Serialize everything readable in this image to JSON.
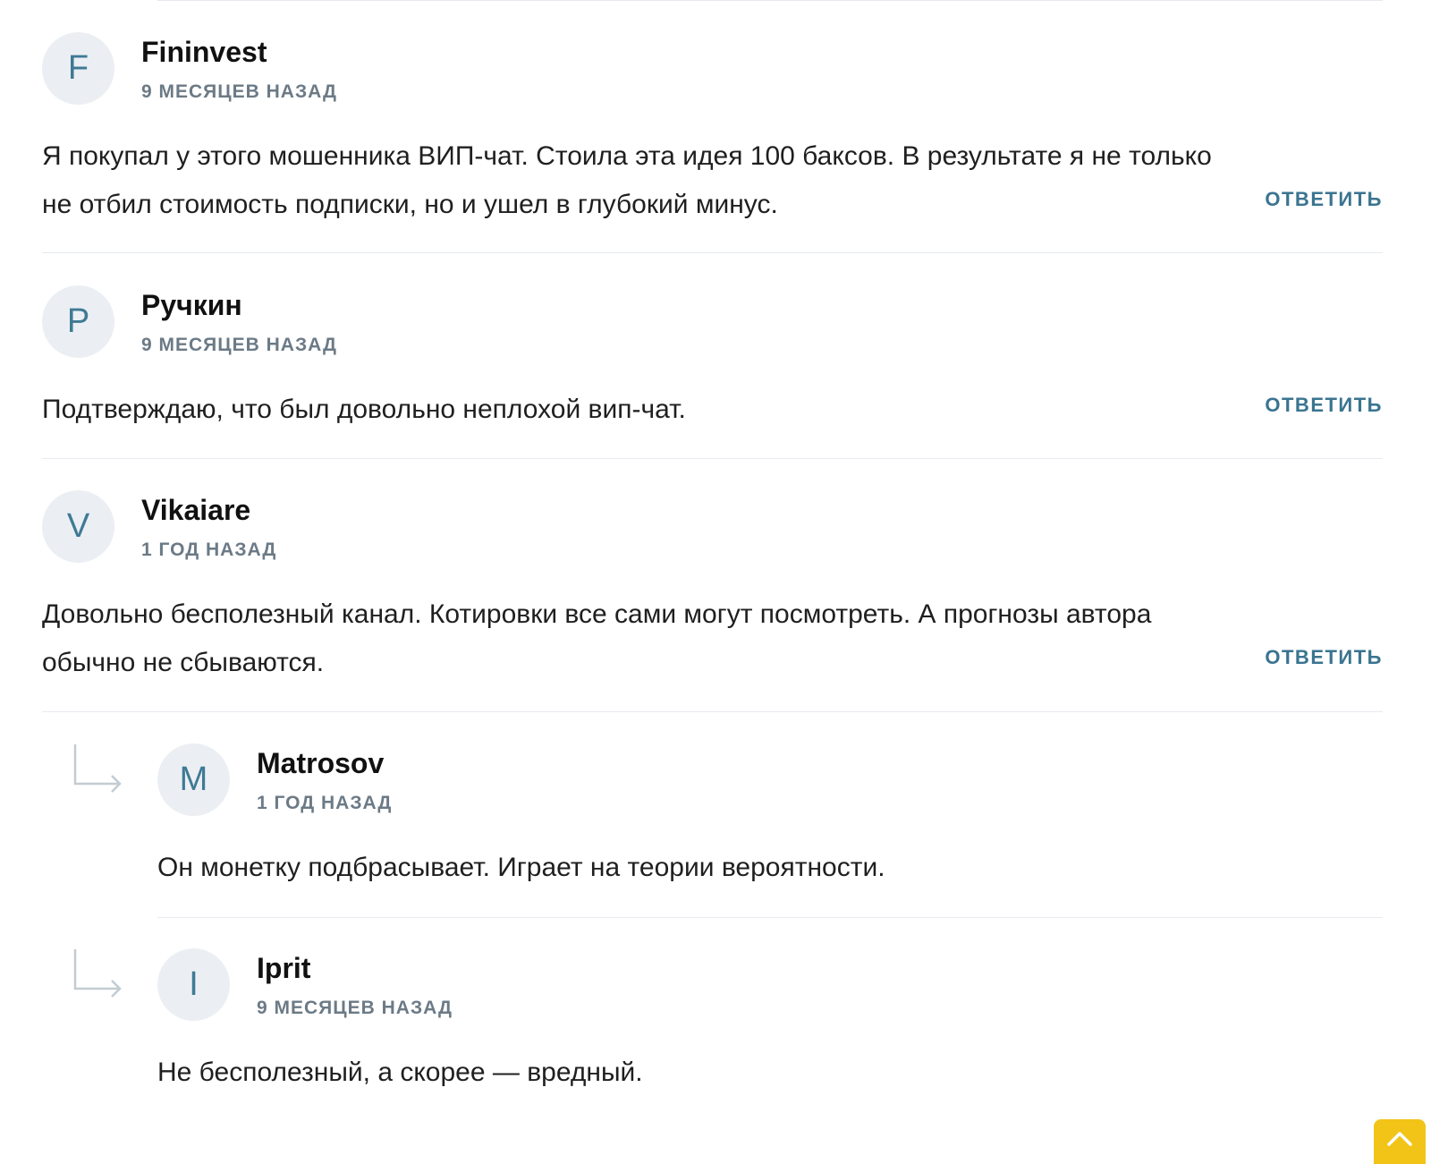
{
  "comments": [
    {
      "avatar_letter": "F",
      "author": "Fininvest",
      "date": "9 МЕСЯЦЕВ НАЗАД",
      "text": "Я покупал у этого мошенника ВИП-чат. Стоила эта идея 100 баксов. В результате я не только не отбил стоимость подписки, но и ушел в глубокий минус.",
      "reply_label": "ОТВЕТИТЬ"
    },
    {
      "avatar_letter": "Р",
      "author": "Ручкин",
      "date": "9 МЕСЯЦЕВ НАЗАД",
      "text": "Подтверждаю, что был довольно неплохой вип-чат.",
      "reply_label": "ОТВЕТИТЬ"
    },
    {
      "avatar_letter": "V",
      "author": "Vikaiare",
      "date": "1 ГОД НАЗАД",
      "text": "Довольно бесполезный канал. Котировки все сами могут посмотреть. А прогнозы автора обычно не сбываются.",
      "reply_label": "ОТВЕТИТЬ"
    }
  ],
  "replies": [
    {
      "avatar_letter": "M",
      "author": "Matrosov",
      "date": "1 ГОД НАЗАД",
      "text": "Он монетку подбрасывает. Играет на теории вероятности."
    },
    {
      "avatar_letter": "I",
      "author": "Iprit",
      "date": "9 МЕСЯЦЕВ НАЗАД",
      "text": "Не бесполезный, а скорее — вредный."
    }
  ],
  "icons": {
    "reply_arrow": "reply-arrow-icon",
    "scroll_top": "chevron-up-icon"
  },
  "colors": {
    "accent": "#3a7490",
    "avatar_bg": "#ebeff3",
    "meta": "#6b7a86",
    "scroll_button": "#f2c418"
  }
}
